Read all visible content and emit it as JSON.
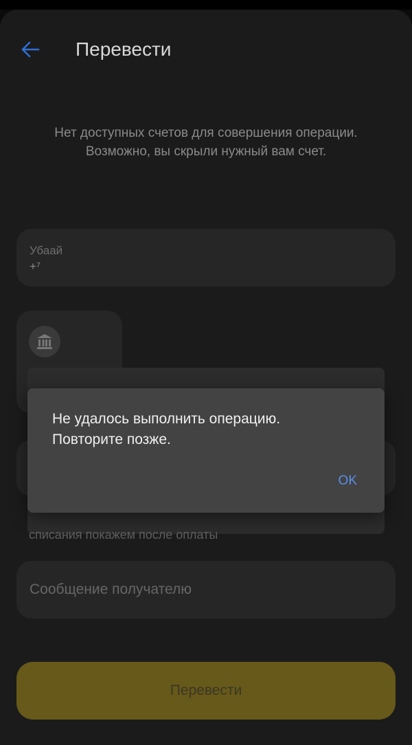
{
  "header": {
    "title": "Перевести",
    "back_icon": "arrow-left-icon",
    "accent_color": "#2f6fd6"
  },
  "notice": "Нет доступных счетов для совершения операции.\nВозможно, вы скрыли нужный вам счет.",
  "recipient": {
    "name": "Убаай",
    "phone": "+⁷"
  },
  "bank": {
    "icon": "bank-icon"
  },
  "fee_note": "списания покажем после оплаты",
  "message": {
    "placeholder": "Сообщение получателю",
    "value": ""
  },
  "submit": {
    "label": "Перевести",
    "color": "#66591a"
  },
  "dialog": {
    "message": "Не удалось выполнить операцию.\nПовторите позже.",
    "ok_label": "OK"
  }
}
